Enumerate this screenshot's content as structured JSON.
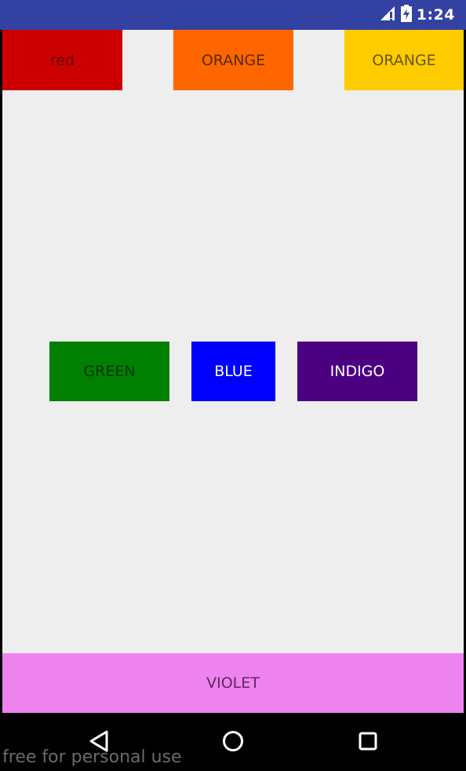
{
  "status_bar": {
    "time": "1:24",
    "icons": [
      "signal-icon",
      "battery-charging-icon"
    ],
    "background": "#3341a2"
  },
  "buttons": {
    "red": {
      "label": "red",
      "color": "#cc0000"
    },
    "orange1": {
      "label": "ORANGE",
      "color": "#ff6600"
    },
    "orange2": {
      "label": "ORANGE",
      "color": "#ffcc00"
    },
    "green": {
      "label": "GREEN",
      "color": "#008000"
    },
    "blue": {
      "label": "BLUE",
      "color": "#0000ff"
    },
    "indigo": {
      "label": "INDIGO",
      "color": "#4b0082"
    },
    "violet": {
      "label": "VIOLET",
      "color": "#ee82ee"
    }
  },
  "nav_bar": {
    "icons": [
      "back-icon",
      "home-icon",
      "recents-icon"
    ]
  },
  "watermark": "free for personal use"
}
